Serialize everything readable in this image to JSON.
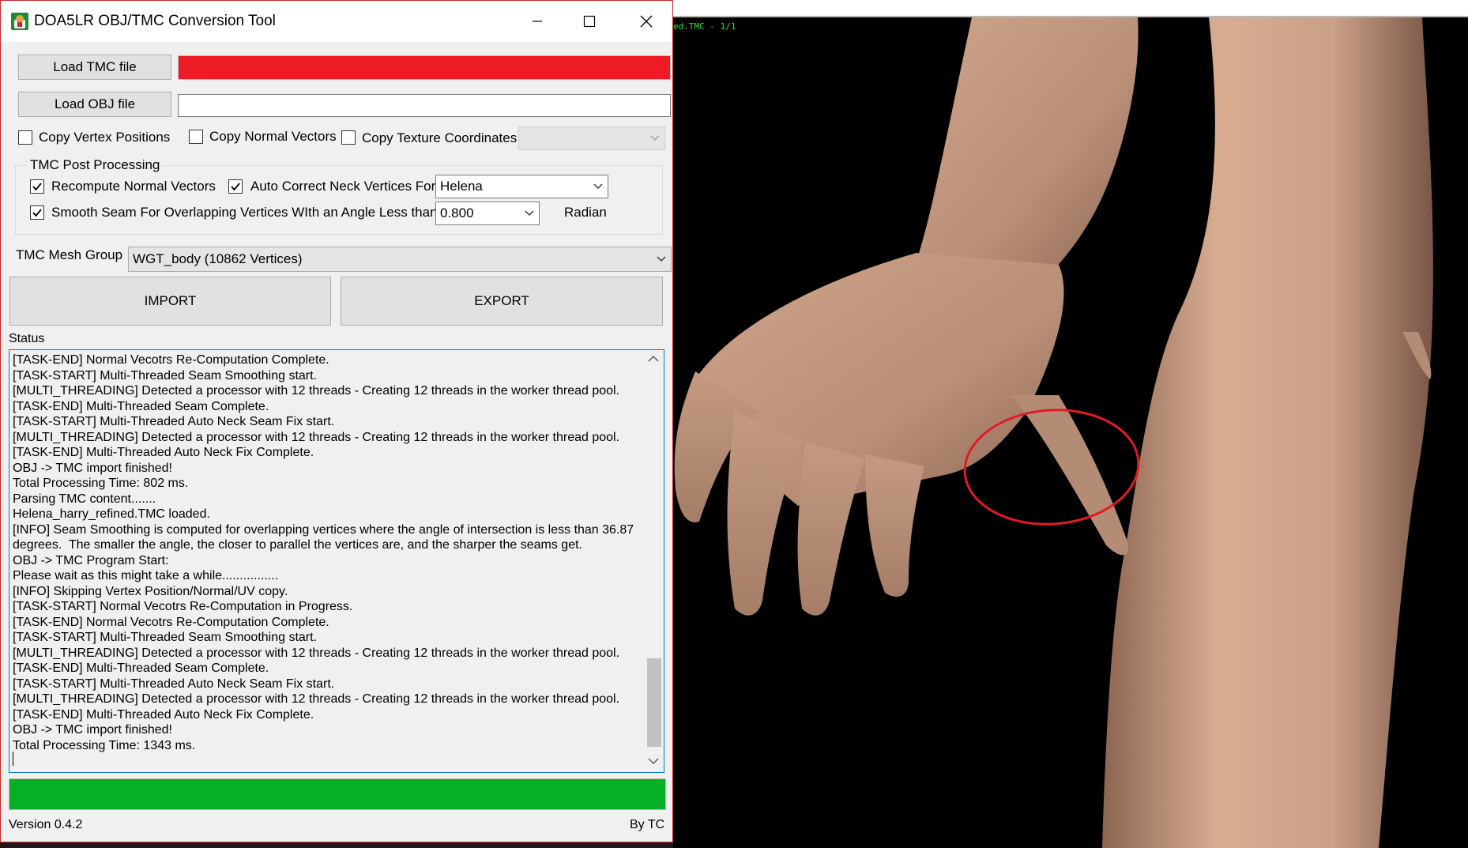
{
  "window": {
    "title": "DOA5LR OBJ/TMC Conversion Tool",
    "accent_color": "#0078d7"
  },
  "load": {
    "tmc_button": "Load TMC file",
    "tmc_field_color": "#ed1c24",
    "obj_button": "Load OBJ file",
    "obj_path": ""
  },
  "copy_options": {
    "vertex_positions": "Copy Vertex Positions",
    "normal_vectors": "Copy Normal Vectors",
    "texture_coordinates": "Copy Texture Coordinates",
    "texture_select_value": ""
  },
  "post_processing": {
    "legend": "TMC Post Processing",
    "recompute_normals": "Recompute Normal Vectors",
    "recompute_normals_checked": true,
    "auto_correct_neck": "Auto Correct Neck Vertices For",
    "auto_correct_neck_checked": true,
    "character": "Helena",
    "smooth_seam": "Smooth Seam For Overlapping Vertices WIth an Angle Less than",
    "smooth_seam_checked": true,
    "angle_value": "0.800",
    "angle_unit": "Radian"
  },
  "mesh_group": {
    "label": "TMC Mesh Group",
    "value": "WGT_body (10862 Vertices)"
  },
  "actions": {
    "import": "IMPORT",
    "export": "EXPORT"
  },
  "status": {
    "label": "Status",
    "lines": [
      "[TASK-END] Normal Vecotrs Re-Computation Complete.",
      "[TASK-START] Multi-Threaded Seam Smoothing start.",
      "[MULTI_THREADING] Detected a processor with 12 threads - Creating 12 threads in the worker thread pool.",
      "[TASK-END] Multi-Threaded Seam Complete.",
      "[TASK-START] Multi-Threaded Auto Neck Seam Fix start.",
      "[MULTI_THREADING] Detected a processor with 12 threads - Creating 12 threads in the worker thread pool.",
      "[TASK-END] Multi-Threaded Auto Neck Fix Complete.",
      "OBJ -> TMC import finished!",
      "Total Processing Time: 802 ms.",
      "Parsing TMC content.......",
      "Helena_harry_refined.TMC loaded.",
      "[INFO] Seam Smoothing is computed for overlapping vertices where the angle of intersection is less than 36.87 degrees.  The smaller the angle, the closer to parallel the vertices are, and the sharper the seams get.",
      "OBJ -> TMC Program Start:",
      "Please wait as this might take a while................",
      "[INFO] Skipping Vertex Position/Normal/UV copy.",
      "[TASK-START] Normal Vecotrs Re-Computation in Progress.",
      "[TASK-END] Normal Vecotrs Re-Computation Complete.",
      "[TASK-START] Multi-Threaded Seam Smoothing start.",
      "[MULTI_THREADING] Detected a processor with 12 threads - Creating 12 threads in the worker thread pool.",
      "[TASK-END] Multi-Threaded Seam Complete.",
      "[TASK-START] Multi-Threaded Auto Neck Seam Fix start.",
      "[MULTI_THREADING] Detected a processor with 12 threads - Creating 12 threads in the worker thread pool.",
      "[TASK-END] Multi-Threaded Auto Neck Fix Complete.",
      "OBJ -> TMC import finished!",
      "Total Processing Time: 1343 ms."
    ]
  },
  "progress": {
    "value_percent": 100,
    "color": "#06b025"
  },
  "footer": {
    "version": "Version 0.4.2",
    "author": "By TC"
  },
  "viewer": {
    "status_text": "ed.TMC - 1/1",
    "status_color": "#28e028",
    "highlight_color": "#e01b24"
  }
}
